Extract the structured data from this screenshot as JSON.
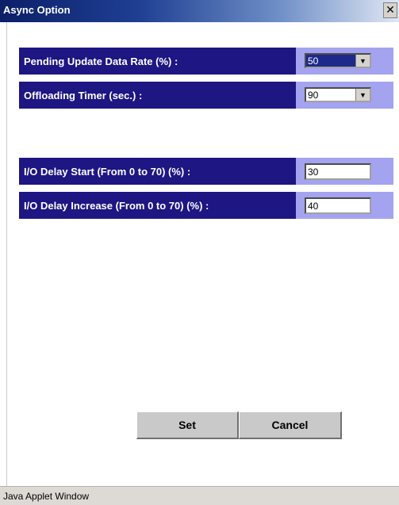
{
  "window": {
    "title": "Async Option",
    "close_glyph": "✕",
    "close_icon": "close-icon"
  },
  "settings": {
    "pending_update": {
      "label": "Pending Update Data Rate (%) :",
      "value": "50"
    },
    "offloading_timer": {
      "label": "Offloading Timer (sec.) :",
      "value": "90"
    },
    "io_delay_start": {
      "label": "I/O Delay Start (From 0 to 70) (%) :",
      "value": "30"
    },
    "io_delay_increase": {
      "label": "I/O Delay Increase (From 0 to 70) (%) :",
      "value": "40"
    }
  },
  "icons": {
    "dropdown_arrow": "▼",
    "dropdown_icon": "chevron-down-icon"
  },
  "buttons": {
    "set_label": "Set",
    "cancel_label": "Cancel"
  },
  "status": {
    "text": "Java Applet Window"
  },
  "colors": {
    "label_bg": "#1d1683",
    "control_bg": "#a3a3f0",
    "title_gradient_start": "#0c1f68"
  }
}
